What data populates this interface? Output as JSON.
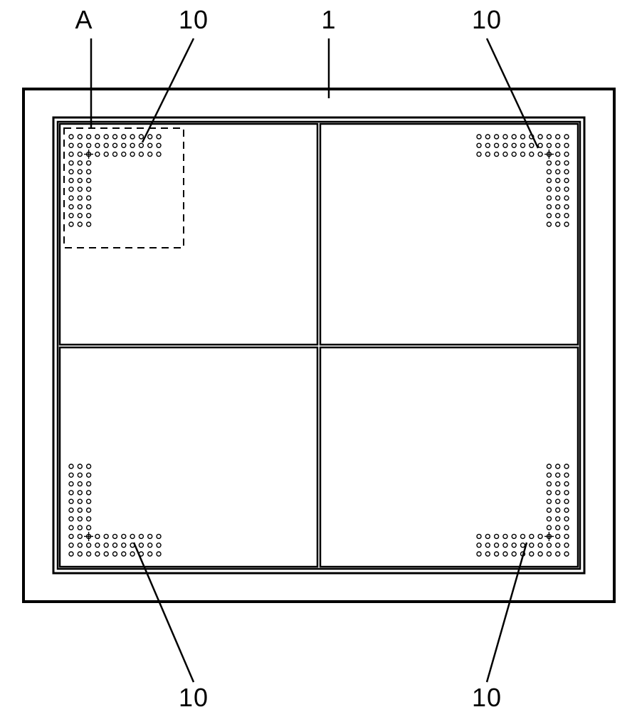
{
  "labels": {
    "A": "A",
    "ref_substrate": "1",
    "ref_marker_TL": "10",
    "ref_marker_TR": "10",
    "ref_marker_BL": "10",
    "ref_marker_BR": "10"
  },
  "figure": {
    "description": "Top view of a rectangular substrate (1) divided into four quadrants. Each outer corner of the four-quadrant area has an L-shaped pattern of small circles (dot-matrix alignment marks, 10). A dashed box around the top-left marker is labeled A.",
    "callouts": [
      {
        "id": "A",
        "target": "dashed detail box around top-left marker"
      },
      {
        "id": "1",
        "target": "outer substrate rectangle"
      },
      {
        "id": "10",
        "target": "top-left L-shaped dot marker"
      },
      {
        "id": "10",
        "target": "top-right L-shaped dot marker"
      },
      {
        "id": "10",
        "target": "bottom-left L-shaped dot marker"
      },
      {
        "id": "10",
        "target": "bottom-right L-shaped dot marker"
      }
    ],
    "marker_dot_grid": {
      "rows": 3,
      "cols_long_arm": 11,
      "cols_short_arm_below": 8,
      "dot_style": "small open circles"
    }
  }
}
